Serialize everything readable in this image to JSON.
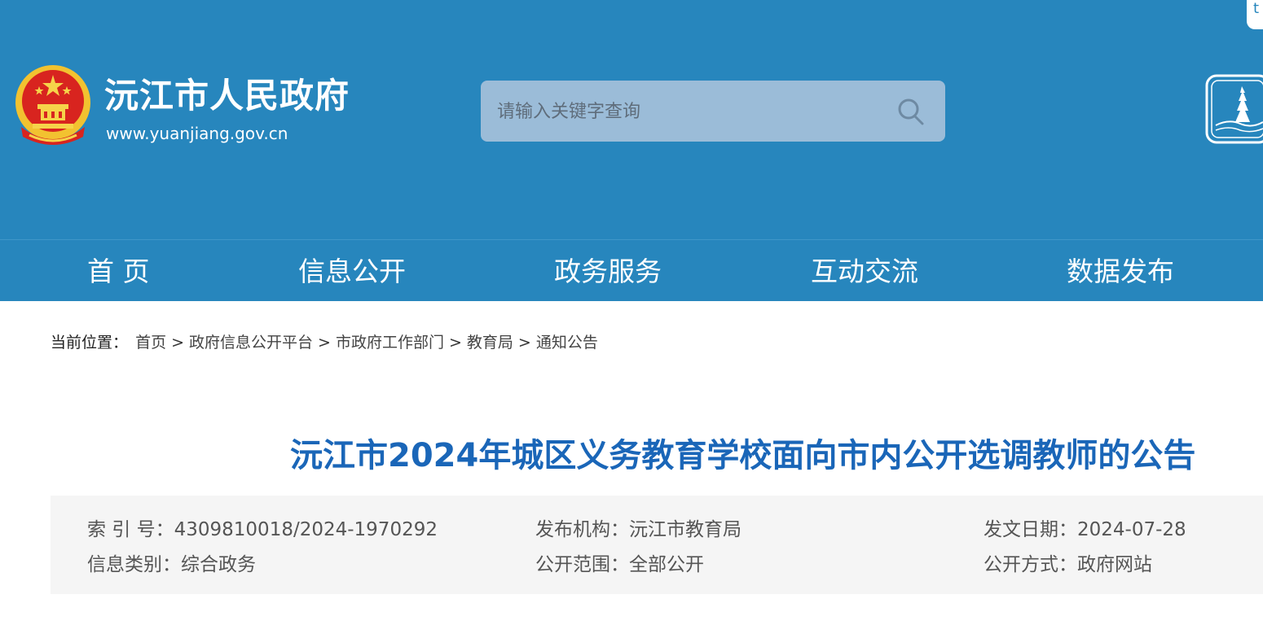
{
  "header": {
    "site_name": "沅江市人民政府",
    "site_url": "www.yuanjiang.gov.cn",
    "search": {
      "placeholder": "请输入关键字查询"
    },
    "corner_label": "t"
  },
  "nav": {
    "items": [
      {
        "label": "首 页"
      },
      {
        "label": "信息公开"
      },
      {
        "label": "政务服务"
      },
      {
        "label": "互动交流"
      },
      {
        "label": "数据发布"
      }
    ]
  },
  "breadcrumb": {
    "label": "当前位置：",
    "items": [
      "首页",
      "政府信息公开平台",
      "市政府工作部门",
      "教育局",
      "通知公告"
    ],
    "separator": ">"
  },
  "article": {
    "title": "沅江市2024年城区义务教育学校面向市内公开选调教师的公告"
  },
  "meta": {
    "index_no": {
      "label": "索 引 号：",
      "value": "4309810018/2024-1970292"
    },
    "publisher": {
      "label": "发布机构：",
      "value": "沅江市教育局"
    },
    "date": {
      "label": "发文日期：",
      "value": "2024-07-28"
    },
    "category": {
      "label": "信息类别：",
      "value": "综合政务"
    },
    "scope": {
      "label": "公开范围：",
      "value": "全部公开"
    },
    "method": {
      "label": "公开方式：",
      "value": "政府网站"
    }
  },
  "colors": {
    "header_bg": "#2786bd",
    "title_blue": "#1a66b8",
    "meta_bg": "#f5f5f5"
  }
}
